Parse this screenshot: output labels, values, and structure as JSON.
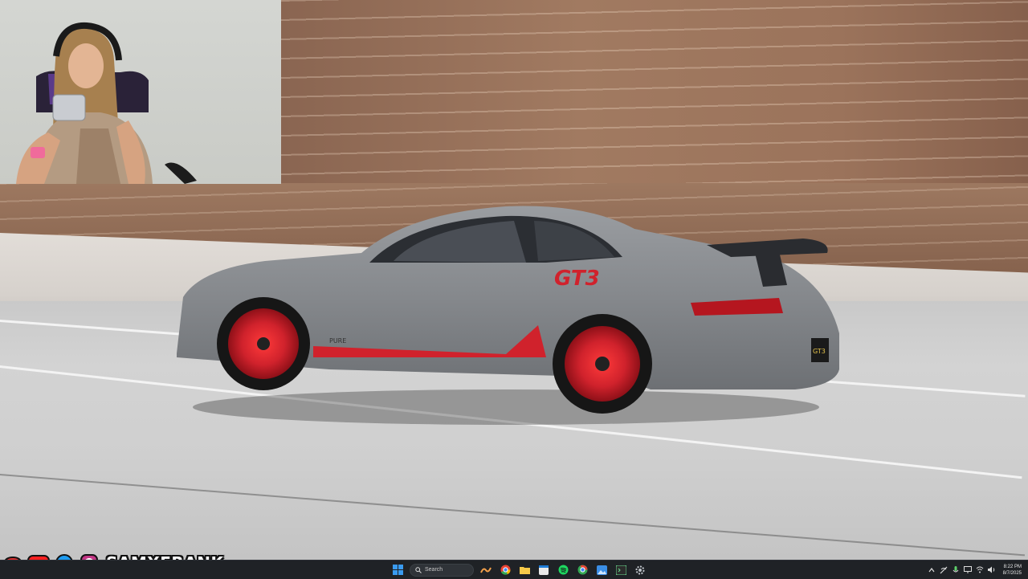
{
  "overlay": {
    "handle": "SAMXFRANK",
    "icons": [
      "logo-icon",
      "youtube-icon",
      "twitter-icon",
      "instagram-icon"
    ]
  },
  "wallpaper": {
    "badge_text": "GT3",
    "plate_text": "GT3",
    "door_brand": "PURE"
  },
  "taskbar": {
    "search_placeholder": "Search",
    "apps": [
      "widgets-icon",
      "chrome-icon",
      "file-explorer-icon",
      "calendar-app-icon",
      "spotify-icon",
      "chrome-alt-icon",
      "photos-icon",
      "terminal-icon",
      "settings-icon"
    ],
    "tray_icons": [
      "chevron-up-icon",
      "network-icon",
      "mic-icon",
      "display-icon",
      "wifi-icon",
      "volume-icon"
    ],
    "time": "8:22 PM",
    "date": "8/7/2025"
  },
  "colors": {
    "taskbar_bg": "#1f2226",
    "accent_red": "#d0222c",
    "car_grey": "#8a8d91"
  }
}
